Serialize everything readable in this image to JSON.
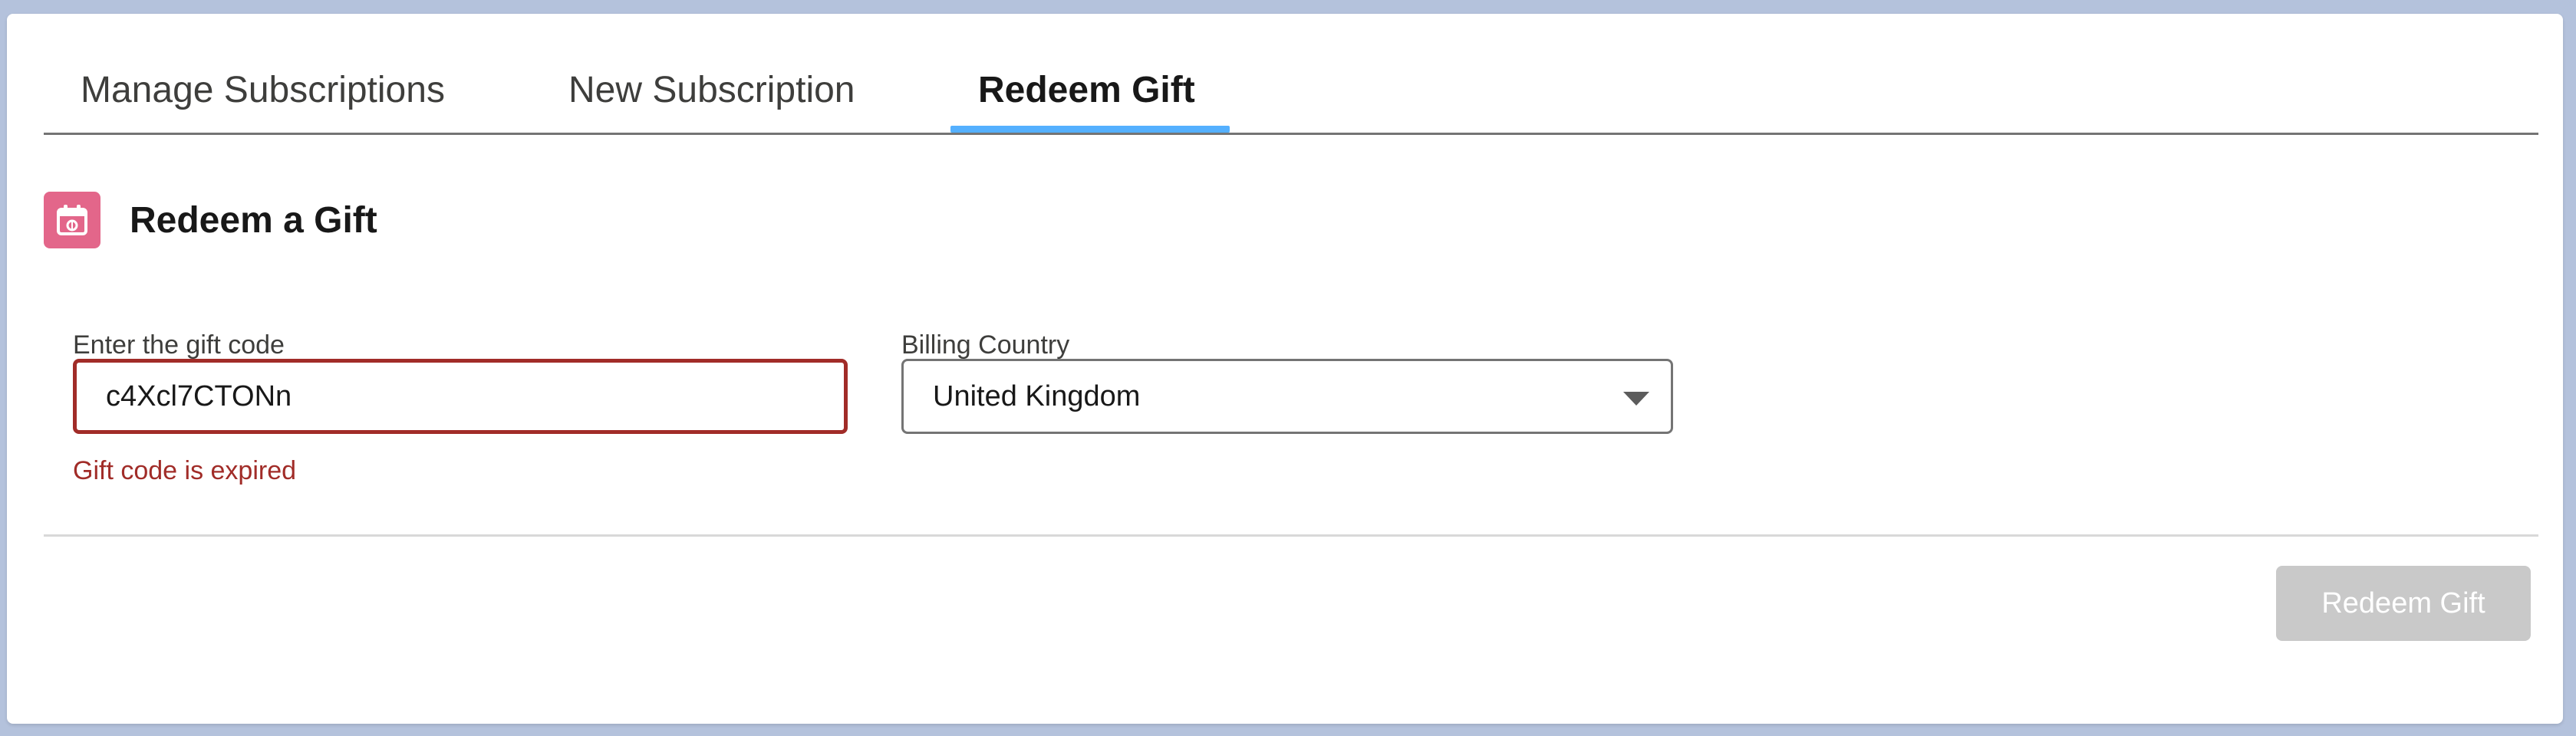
{
  "tabs": [
    {
      "label": "Manage Subscriptions"
    },
    {
      "label": "New Subscription"
    },
    {
      "label": "Redeem Gift"
    }
  ],
  "section": {
    "icon": "gift-calendar-icon",
    "title": "Redeem a Gift",
    "icon_color": "#e3668a"
  },
  "gift_code": {
    "label": "Enter the gift code",
    "value": "c4Xcl7CTONn",
    "error": "Gift code is expired",
    "error_color": "#a12c28"
  },
  "billing_country": {
    "label": "Billing Country",
    "value": "United Kingdom"
  },
  "actions": {
    "redeem_label": "Redeem Gift"
  },
  "colors": {
    "active_tab_indicator": "#1b96ff",
    "disabled_button": "#c9c9c9"
  }
}
